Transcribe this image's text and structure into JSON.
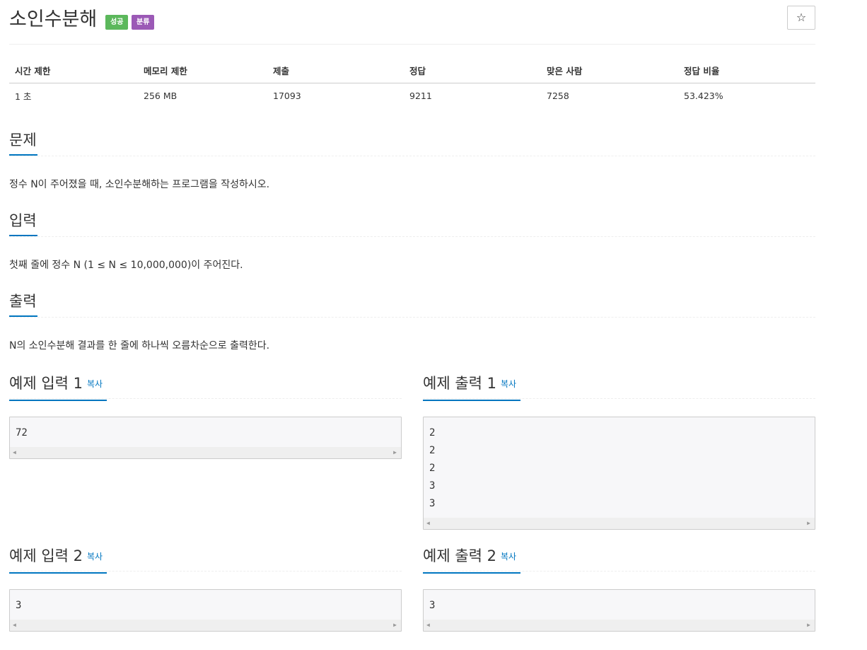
{
  "header": {
    "title": "소인수분해",
    "badge_success": "성공",
    "badge_category": "분류",
    "star": "☆"
  },
  "info": {
    "headers": [
      "시간 제한",
      "메모리 제한",
      "제출",
      "정답",
      "맞은 사람",
      "정답 비율"
    ],
    "values": [
      "1 초",
      "256 MB",
      "17093",
      "9211",
      "7258",
      "53.423%"
    ]
  },
  "problem": {
    "heading": "문제",
    "text": "정수 N이 주어졌을 때, 소인수분해하는 프로그램을 작성하시오."
  },
  "input": {
    "heading": "입력",
    "text": "첫째 줄에 정수 N (1 ≤ N ≤ 10,000,000)이 주어진다."
  },
  "output": {
    "heading": "출력",
    "text": "N의 소인수분해 결과를 한 줄에 하나씩 오름차순으로 출력한다."
  },
  "samples": {
    "copy_label": "복사",
    "input1": {
      "heading": "예제 입력 1",
      "content": "72"
    },
    "output1": {
      "heading": "예제 출력 1",
      "content": "2\n2\n2\n3\n3"
    },
    "input2": {
      "heading": "예제 입력 2",
      "content": "3"
    },
    "output2": {
      "heading": "예제 출력 2",
      "content": "3"
    }
  },
  "colors": {
    "success": "#5cb85c",
    "category": "#9b59b6",
    "accent": "#0076c0"
  }
}
